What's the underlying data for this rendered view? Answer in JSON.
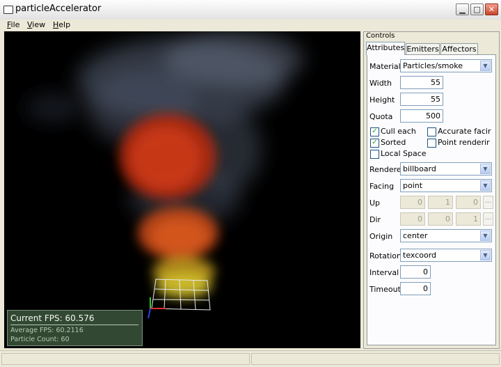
{
  "window": {
    "title": "particleAccelerator"
  },
  "menu": [
    {
      "key": "F",
      "rest": "ile"
    },
    {
      "key": "V",
      "rest": "iew"
    },
    {
      "key": "H",
      "rest": "elp"
    }
  ],
  "stats": {
    "current_fps": "Current  FPS:  60.576",
    "average_fps": "Average  FPS:  60.2116",
    "particle_count": "Particle  Count:  60"
  },
  "controls": {
    "title": "Controls",
    "tabs": [
      "Attributes",
      "Emitters",
      "Affectors"
    ],
    "active_tab": "Attributes",
    "material_label": "Material",
    "material_value": "Particles/smoke",
    "width_label": "Width",
    "width_value": "55",
    "height_label": "Height",
    "height_value": "55",
    "quota_label": "Quota",
    "quota_value": "500",
    "checkboxes": [
      {
        "label": "Cull each",
        "checked": true
      },
      {
        "label": "Accurate facir",
        "checked": false
      },
      {
        "label": "Sorted",
        "checked": true
      },
      {
        "label": "Point renderir",
        "checked": false
      },
      {
        "label": "Local Space",
        "checked": false
      }
    ],
    "renderer_label": "Rendere",
    "renderer_value": "billboard",
    "facing_label": "Facing",
    "facing_value": "point",
    "up_label": "Up",
    "up_values": [
      "0",
      "1",
      "0"
    ],
    "dir_label": "Dir",
    "dir_values": [
      "0",
      "0",
      "1"
    ],
    "ellipsis": "...",
    "origin_label": "Origin",
    "origin_value": "center",
    "rotation_label": "Rotation",
    "rotation_value": "texcoord",
    "interval_label": "Interval",
    "interval_value": "0",
    "timeout_label": "Timeout",
    "timeout_value": "0"
  },
  "icons": [
    "app-window-icon",
    "minimize-icon",
    "maximize-icon",
    "close-icon",
    "dropdown-arrow-icon",
    "checkmark-icon",
    "axis-gizmo-icon"
  ],
  "colors": {
    "titlebar": "#e2e2e2",
    "close": "#c8452a",
    "fps_panel": "#364e36",
    "checkmark": "#21a121"
  }
}
